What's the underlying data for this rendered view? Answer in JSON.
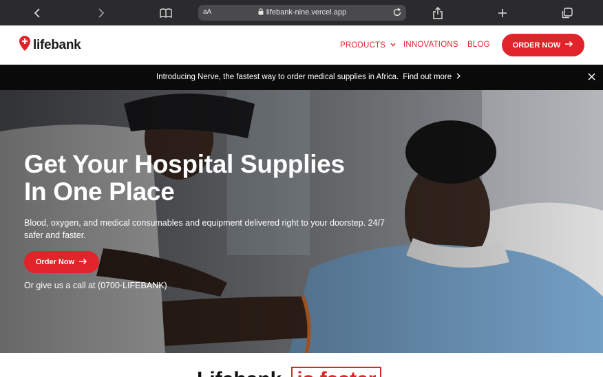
{
  "browser": {
    "text_size_label": "aA",
    "url": "lifebank-nine.vercel.app"
  },
  "header": {
    "logo_text": "lifebank",
    "nav": {
      "products": "PRODUCTS",
      "innovations": "INNOVATIONS",
      "blog": "BLOG"
    },
    "order_button": "ORDER NOW"
  },
  "announcement": {
    "text": "Introducing Nerve, the fastest way to order medical supplies in Africa.",
    "link": "Find out more"
  },
  "hero": {
    "title_line1": "Get Your Hospital Supplies",
    "title_line2": "In One Place",
    "subtitle": "Blood, oxygen, and medical consumables and equipment delivered right to your doorstep. 24/7 safer and faster.",
    "button": "Order Now",
    "call_text": "Or give us a call at (0700-LIFEBANK)"
  },
  "section": {
    "heading": "Lifebank",
    "highlight": "is faster"
  },
  "colors": {
    "brand_red": "#e0242a",
    "toolbar": "#2b2b2d",
    "announcement_bg": "#0a0a0a"
  }
}
